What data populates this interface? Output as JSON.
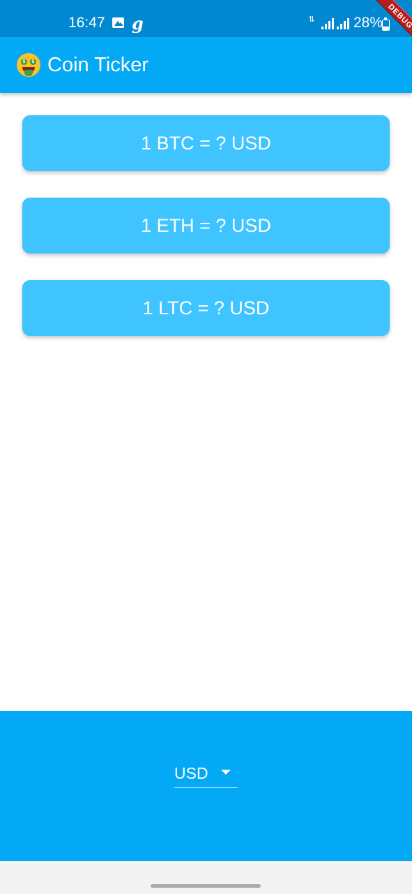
{
  "status_bar": {
    "time": "16:47",
    "gallery_icon": "image-icon",
    "g_icon": "g",
    "data_icon": "⇅",
    "signal_icon": "signal-icon",
    "battery": "28%",
    "battery_icon": "battery-icon",
    "debug_label": "DEBUG"
  },
  "app_bar": {
    "icon": "money-mouth-face-emoji",
    "title": "Coin Ticker",
    "color": "#03a9f4"
  },
  "cards": [
    {
      "label": "1 BTC = ? USD"
    },
    {
      "label": "1 ETH = ? USD"
    },
    {
      "label": "1 LTC = ? USD"
    }
  ],
  "currency_picker": {
    "selected": "USD",
    "arrow_icon": "dropdown-arrow-icon"
  },
  "colors": {
    "status_bar": "#0288d1",
    "primary": "#03a9f4",
    "card": "#40c4ff",
    "debug_banner": "#b71c1c"
  }
}
